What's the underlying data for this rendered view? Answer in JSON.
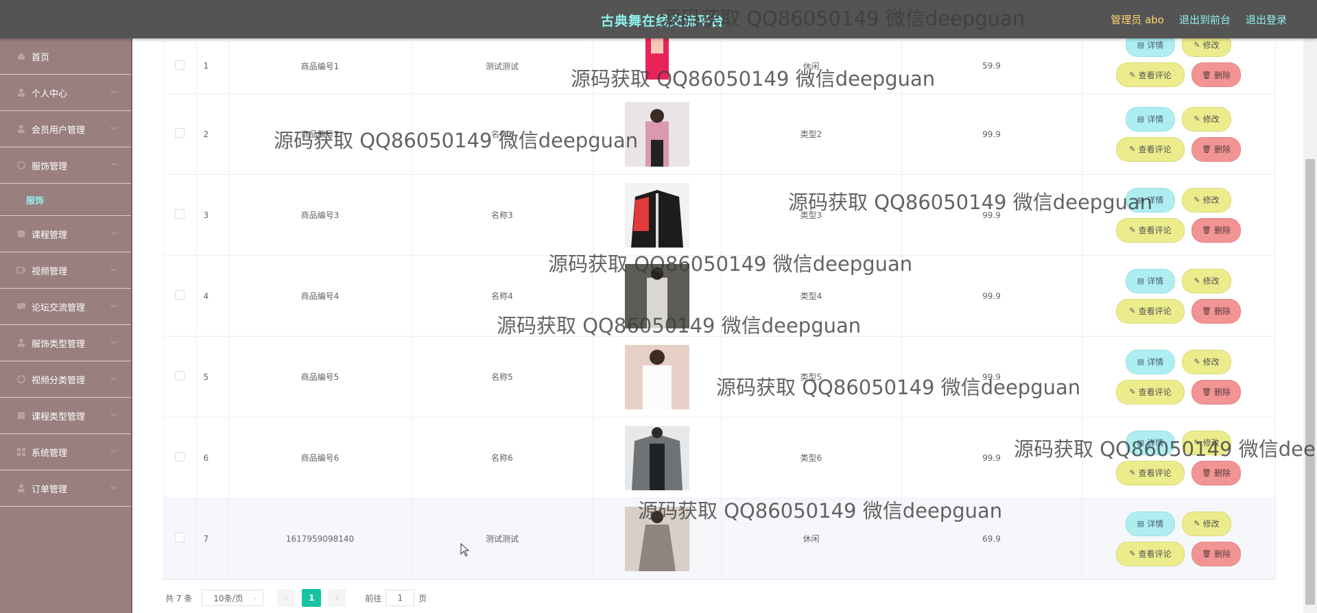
{
  "header": {
    "title": "古典舞在线交流平台",
    "admin_label": "管理员 abo",
    "to_front_label": "退出到前台",
    "logout_label": "退出登录"
  },
  "sidebar": {
    "items": [
      {
        "label": "首页",
        "icon": "home-icon"
      },
      {
        "label": "个人中心",
        "icon": "user-icon"
      },
      {
        "label": "会员用户管理",
        "icon": "user-icon"
      },
      {
        "label": "服饰管理",
        "icon": "shirt-icon"
      },
      {
        "label": "服饰",
        "icon": ""
      },
      {
        "label": "课程管理",
        "icon": "book-icon"
      },
      {
        "label": "视频管理",
        "icon": "video-icon"
      },
      {
        "label": "论坛交流管理",
        "icon": "chat-icon"
      },
      {
        "label": "服饰类型管理",
        "icon": "user-icon"
      },
      {
        "label": "视频分类管理",
        "icon": "video-icon"
      },
      {
        "label": "课程类型管理",
        "icon": "book-icon"
      },
      {
        "label": "系统管理",
        "icon": "grid-icon"
      },
      {
        "label": "订单管理",
        "icon": "user-icon"
      }
    ]
  },
  "table": {
    "rows": [
      {
        "index": "1",
        "code": "商品编号1",
        "name": "测试测试",
        "type": "休闲",
        "price": "59.9"
      },
      {
        "index": "2",
        "code": "商品编号2",
        "name": "名称2",
        "type": "类型2",
        "price": "99.9"
      },
      {
        "index": "3",
        "code": "商品编号3",
        "name": "名称3",
        "type": "类型3",
        "price": "99.9"
      },
      {
        "index": "4",
        "code": "商品编号4",
        "name": "名称4",
        "type": "类型4",
        "price": "99.9"
      },
      {
        "index": "5",
        "code": "商品编号5",
        "name": "名称5",
        "type": "类型5",
        "price": "99.9"
      },
      {
        "index": "6",
        "code": "商品编号6",
        "name": "名称6",
        "type": "类型6",
        "price": "99.9"
      },
      {
        "index": "7",
        "code": "1617959098140",
        "name": "测试测试",
        "type": "休闲",
        "price": "69.9"
      }
    ],
    "buttons": {
      "detail": "详情",
      "edit": "修改",
      "review": "查看评论",
      "delete": "删除"
    }
  },
  "pagination": {
    "total": "共 7 条",
    "page_size": "10条/页",
    "current_page": "1",
    "jump_prefix": "前往",
    "jump_value": "1",
    "jump_suffix": "页"
  },
  "watermark": "源码获取 QQ86050149 微信deepguan",
  "colors": {
    "header_bg": "#545454",
    "title": "#8ff1ee",
    "admin": "#ffd66e",
    "sidebar_bg": "#9a7f7f",
    "pager_active": "#18c3a1",
    "detail_btn": "#aeeef1",
    "edit_btn": "#ecec8c",
    "delete_btn": "#f29494"
  }
}
